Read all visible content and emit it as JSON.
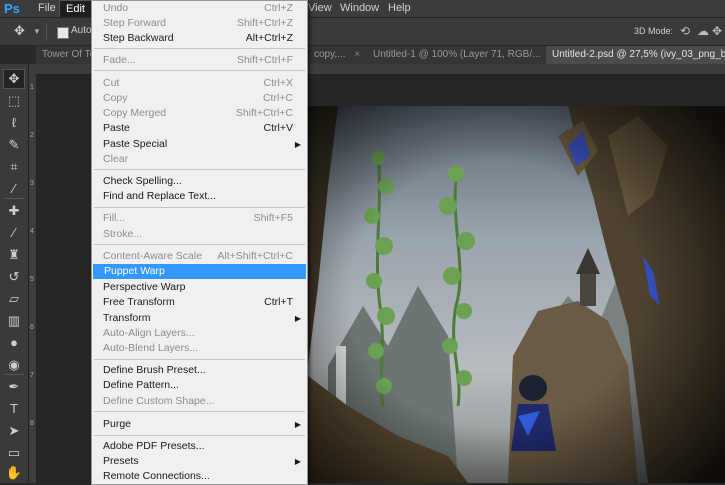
{
  "app": {
    "logo": "Ps"
  },
  "menubar": {
    "items": [
      {
        "label": "File"
      },
      {
        "label": "Edit"
      },
      {
        "label": "View"
      },
      {
        "label": "Window"
      },
      {
        "label": "Help"
      }
    ]
  },
  "options": {
    "auto_label": "Auto-",
    "mode3d_label": "3D Mode:"
  },
  "tabs": [
    {
      "label": "Tower Of Te"
    },
    {
      "label": "copy,..."
    },
    {
      "label": "Untitled-1 @ 100% (Layer 71, RGB/..."
    },
    {
      "label": "Untitled-2.psd @ 27,5% (ivy_03_png_by_g"
    }
  ],
  "ruler": {
    "v": [
      "1",
      "2",
      "3",
      "4",
      "5",
      "6",
      "7",
      "8"
    ]
  },
  "edit_menu": {
    "items": [
      {
        "label": "Undo",
        "shortcut": "Ctrl+Z",
        "disabled": true
      },
      {
        "label": "Step Forward",
        "shortcut": "Shift+Ctrl+Z",
        "disabled": true
      },
      {
        "label": "Step Backward",
        "shortcut": "Alt+Ctrl+Z",
        "disabled": false
      },
      {
        "label": "Fade...",
        "shortcut": "Shift+Ctrl+F",
        "disabled": true
      },
      {
        "label": "Cut",
        "shortcut": "Ctrl+X",
        "disabled": true
      },
      {
        "label": "Copy",
        "shortcut": "Ctrl+C",
        "disabled": true
      },
      {
        "label": "Copy Merged",
        "shortcut": "Shift+Ctrl+C",
        "disabled": true
      },
      {
        "label": "Paste",
        "shortcut": "Ctrl+V",
        "disabled": false
      },
      {
        "label": "Paste Special",
        "shortcut": "",
        "submenu": true,
        "disabled": false
      },
      {
        "label": "Clear",
        "shortcut": "",
        "disabled": true
      },
      {
        "label": "Check Spelling...",
        "shortcut": "",
        "disabled": false
      },
      {
        "label": "Find and Replace Text...",
        "shortcut": "",
        "disabled": false
      },
      {
        "label": "Fill...",
        "shortcut": "Shift+F5",
        "disabled": true
      },
      {
        "label": "Stroke...",
        "shortcut": "",
        "disabled": true
      },
      {
        "label": "Content-Aware Scale",
        "shortcut": "Alt+Shift+Ctrl+C",
        "disabled": true
      },
      {
        "label": "Puppet Warp",
        "shortcut": "",
        "disabled": false,
        "highlighted": true
      },
      {
        "label": "Perspective Warp",
        "shortcut": "",
        "disabled": false
      },
      {
        "label": "Free Transform",
        "shortcut": "Ctrl+T",
        "disabled": false
      },
      {
        "label": "Transform",
        "shortcut": "",
        "submenu": true,
        "disabled": false
      },
      {
        "label": "Auto-Align Layers...",
        "shortcut": "",
        "disabled": true
      },
      {
        "label": "Auto-Blend Layers...",
        "shortcut": "",
        "disabled": true
      },
      {
        "label": "Define Brush Preset...",
        "shortcut": "",
        "disabled": false
      },
      {
        "label": "Define Pattern...",
        "shortcut": "",
        "disabled": false
      },
      {
        "label": "Define Custom Shape...",
        "shortcut": "",
        "disabled": true
      },
      {
        "label": "Purge",
        "shortcut": "",
        "submenu": true,
        "disabled": false
      },
      {
        "label": "Adobe PDF Presets...",
        "shortcut": "",
        "disabled": false
      },
      {
        "label": "Presets",
        "shortcut": "",
        "submenu": true,
        "disabled": false
      },
      {
        "label": "Remote Connections...",
        "shortcut": "",
        "disabled": false
      }
    ]
  },
  "colors": {
    "accent": "#3399ff",
    "app_bg": "#282828",
    "menu_bg": "#f0f0f0"
  },
  "icons": {
    "move": "move-tool-icon",
    "marquee": "marquee-tool-icon",
    "lasso": "lasso-tool-icon",
    "quick_select": "quick-select-tool-icon",
    "crop": "crop-tool-icon",
    "eyedropper": "eyedropper-tool-icon",
    "healing": "healing-brush-icon",
    "brush": "brush-tool-icon",
    "stamp": "clone-stamp-icon",
    "history": "history-brush-icon",
    "eraser": "eraser-tool-icon",
    "gradient": "gradient-tool-icon",
    "blur": "blur-tool-icon",
    "dodge": "dodge-tool-icon",
    "pen": "pen-tool-icon",
    "type": "type-tool-icon",
    "path_select": "path-selection-icon",
    "shape": "shape-tool-icon",
    "hand": "hand-tool-icon"
  }
}
